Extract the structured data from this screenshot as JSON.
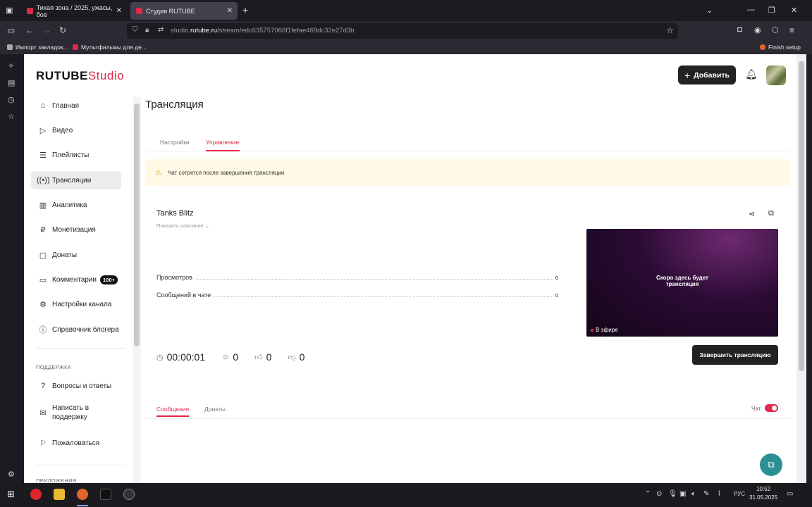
{
  "browser": {
    "tabs": [
      {
        "title": "Тихая зона / 2025, ужасы, бое",
        "active": false
      },
      {
        "title": "Студия RUTUBE",
        "active": true
      }
    ],
    "url_prefix": "studio.",
    "url_domain": "rutube.ru",
    "url_path": "/stream/edc635757066f1fefae469dc32e27d3b",
    "bookmarks": [
      "Импорт закладок...",
      "Мультфильмы для де...",
      "Finish setup"
    ]
  },
  "header": {
    "logo_main": "RUTUBE",
    "logo_sub": "Studio",
    "add_label": "Добавить"
  },
  "sidebar": {
    "items": [
      {
        "label": "Главная",
        "icon": "home-icon"
      },
      {
        "label": "Видео",
        "icon": "video-icon"
      },
      {
        "label": "Плейлисты",
        "icon": "playlist-icon"
      },
      {
        "label": "Трансляции",
        "icon": "broadcast-icon",
        "active": true
      },
      {
        "label": "Аналитика",
        "icon": "chart-icon"
      },
      {
        "label": "Монетизация",
        "icon": "ruble-icon"
      },
      {
        "label": "Донаты",
        "icon": "donate-icon"
      },
      {
        "label": "Комментарии",
        "icon": "comment-icon",
        "badge": "100+"
      },
      {
        "label": "Настройки канала",
        "icon": "gear-icon"
      },
      {
        "label": "Справочник блогера",
        "icon": "info-icon"
      }
    ],
    "support_section": "ПОДДЕРЖКА",
    "support_items": [
      {
        "label": "Вопросы и ответы",
        "icon": "question-icon"
      },
      {
        "label": "Написать в поддержку",
        "icon": "mail-icon"
      },
      {
        "label": "Пожаловаться",
        "icon": "flag-icon"
      }
    ],
    "apps_section": "ПРИЛОЖЕНИЯ"
  },
  "main": {
    "title": "Трансляция",
    "tabs": [
      {
        "label": "Настройки",
        "active": false
      },
      {
        "label": "Управление",
        "active": true
      }
    ],
    "notice": "Чат сотрется после завершения трансляции",
    "stream": {
      "title": "Tanks Blitz",
      "show_description": "Показать описание",
      "stats": [
        {
          "label": "Просмотров",
          "value": "0"
        },
        {
          "label": "Сообщений в чате",
          "value": "0"
        }
      ],
      "preview_text_line1": "Скоро здесь будет",
      "preview_text_line2": "трансляция",
      "live_label": "В эфире",
      "timer": "00:00:01",
      "viewers": "0",
      "likes": "0",
      "dislikes": "0",
      "finish_label": "Завершить трансляцию"
    },
    "chat": {
      "tabs": [
        {
          "label": "Сообщения",
          "active": true
        },
        {
          "label": "Донаты",
          "active": false
        }
      ],
      "toggle_label": "Чат",
      "toggle_on": true
    }
  },
  "taskbar": {
    "lang": "РУС",
    "time": "10:52",
    "date": "31.05.2025"
  },
  "colors": {
    "accent": "#e1284b",
    "dark_button": "#222222",
    "notice_bg": "#fff9e5",
    "fab": "#2c8f95"
  }
}
